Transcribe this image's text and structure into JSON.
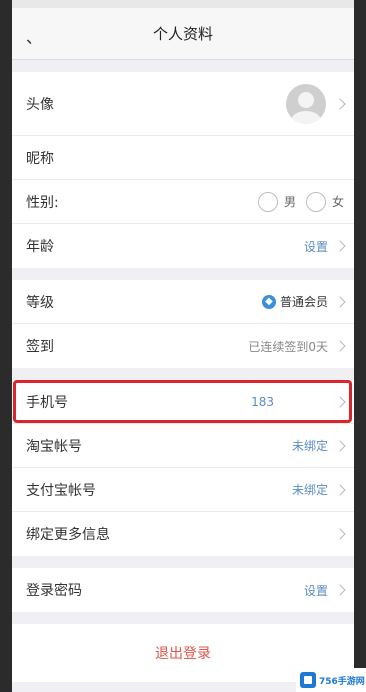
{
  "nav": {
    "back": "、",
    "title": "个人资料"
  },
  "profile": {
    "avatar_label": "头像",
    "nickname_label": "昵称",
    "gender_label": "性别:",
    "gender_options": [
      "男",
      "女"
    ],
    "age_label": "年龄",
    "age_value": "设置"
  },
  "membership": {
    "level_label": "等级",
    "level_icon": "member-badge-icon",
    "level_value": "普通会员",
    "checkin_label": "签到",
    "checkin_value": "已连续签到0天"
  },
  "accounts": {
    "phone_label": "手机号",
    "phone_value": "183",
    "taobao_label": "淘宝帐号",
    "taobao_value": "未绑定",
    "alipay_label": "支付宝帐号",
    "alipay_value": "未绑定",
    "more_label": "绑定更多信息"
  },
  "security": {
    "password_label": "登录密码",
    "password_value": "设置"
  },
  "logout_label": "退出登录",
  "watermark": "756手游网",
  "colors": {
    "link_blue": "#5a8cc6",
    "highlight_red": "#d8262c",
    "logout_red": "#e0544c"
  }
}
